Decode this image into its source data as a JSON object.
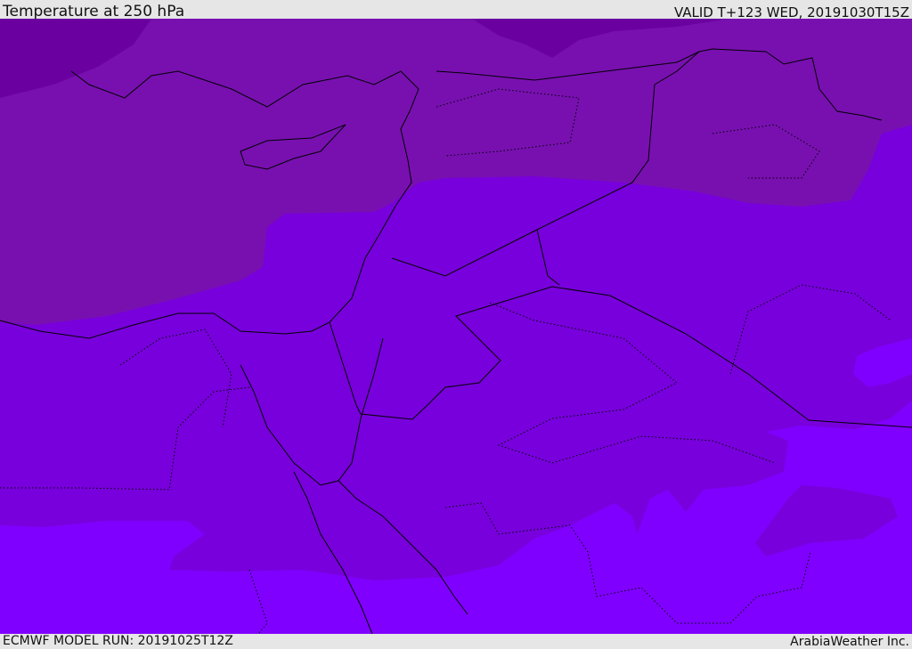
{
  "header": {
    "title": "Temperature at 250 hPa",
    "valid": "VALID T+123 WED, 20191030T15Z"
  },
  "footer": {
    "model_run": "ECMWF MODEL RUN: 20191025T12Z",
    "credit": "ArabiaWeather Inc."
  },
  "colors": {
    "darkest": "#6400a0",
    "upper": "#7810b0",
    "middle": "#7800dc",
    "lower": "#8000ff",
    "borders": "#000000"
  }
}
